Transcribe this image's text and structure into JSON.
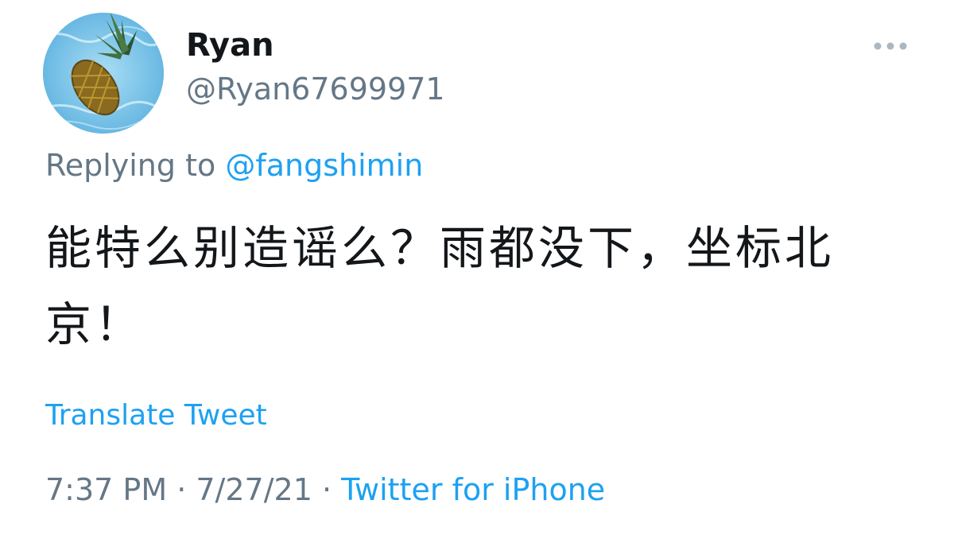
{
  "author": {
    "display_name": "Ryan",
    "handle": "@Ryan67699971",
    "avatar_icon": "pineapple-in-pool-avatar"
  },
  "more_icon": "more-horizontal-icon",
  "reply": {
    "prefix": "Replying to",
    "mention": "@fangshimin"
  },
  "tweet": {
    "text": "能特么别造谣么？雨都没下，坐标北京！"
  },
  "translate_label": "Translate Tweet",
  "meta": {
    "time": "7:37 PM",
    "separator": " · ",
    "date": "7/27/21",
    "source": "Twitter for iPhone"
  },
  "colors": {
    "text_primary": "#14171a",
    "text_secondary": "#657786",
    "link_blue": "#1da1f2"
  }
}
